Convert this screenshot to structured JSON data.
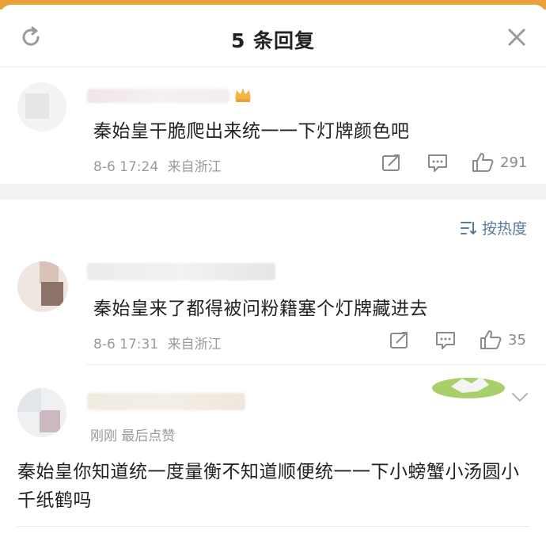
{
  "header": {
    "title": "5 条回复"
  },
  "comments": [
    {
      "text": "秦始皇干脆爬出来统一一下灯牌颜色吧",
      "time": "8-6 17:24",
      "location": "来自浙江",
      "likes": "291"
    },
    {
      "text": "秦始皇来了都得被问粉籍塞个灯牌藏进去",
      "time": "8-6 17:31",
      "location": "来自浙江",
      "likes": "35"
    },
    {
      "meta": "刚刚 最后点赞",
      "text": "秦始皇你知道统一度量衡不知道顺便统一一下小螃蟹小汤圆小千纸鹤吗"
    }
  ],
  "sort": {
    "label": "按热度"
  },
  "icons": {
    "refresh": "refresh-icon",
    "close": "close-icon",
    "share": "share-icon",
    "comment": "comment-icon",
    "like": "thumbs-up-icon",
    "sort": "sort-icon",
    "crown": "crown-icon",
    "chevron": "chevron-down-icon"
  },
  "colors": {
    "accent_link": "#5a7a9c",
    "meta_gray": "#9a9a9a",
    "crown_gold": "#e9a23b"
  }
}
